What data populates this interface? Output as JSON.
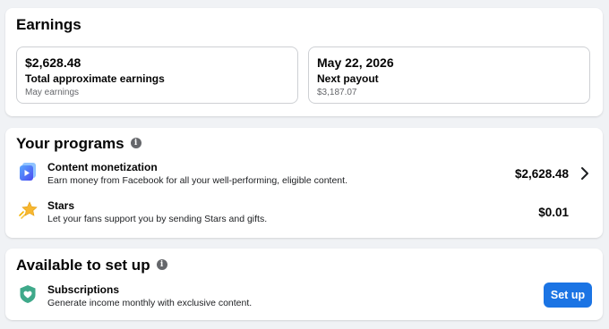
{
  "earnings": {
    "title": "Earnings",
    "total": {
      "value": "$2,628.48",
      "label": "Total approximate earnings",
      "sub": "May earnings"
    },
    "payout": {
      "value": "May 22, 2026",
      "label": "Next payout",
      "sub": "$3,187.07"
    }
  },
  "programs": {
    "title": "Your programs",
    "info_icon": "info-icon",
    "items": [
      {
        "icon": "content-monetization-icon",
        "title": "Content monetization",
        "desc": "Earn money from Facebook for all your well-performing, eligible content.",
        "amount": "$2,628.48",
        "has_chevron": true
      },
      {
        "icon": "star-icon",
        "title": "Stars",
        "desc": "Let your fans support you by sending Stars and gifts.",
        "amount": "$0.01",
        "has_chevron": false
      }
    ]
  },
  "setup": {
    "title": "Available to set up",
    "info_icon": "info-icon",
    "items": [
      {
        "icon": "subscriptions-heart-icon",
        "title": "Subscriptions",
        "desc": "Generate income monthly with exclusive content.",
        "button": "Set up"
      }
    ]
  },
  "colors": {
    "accent": "#1b74e4",
    "background": "#f0f2f5",
    "secondary_text": "#65676b"
  }
}
